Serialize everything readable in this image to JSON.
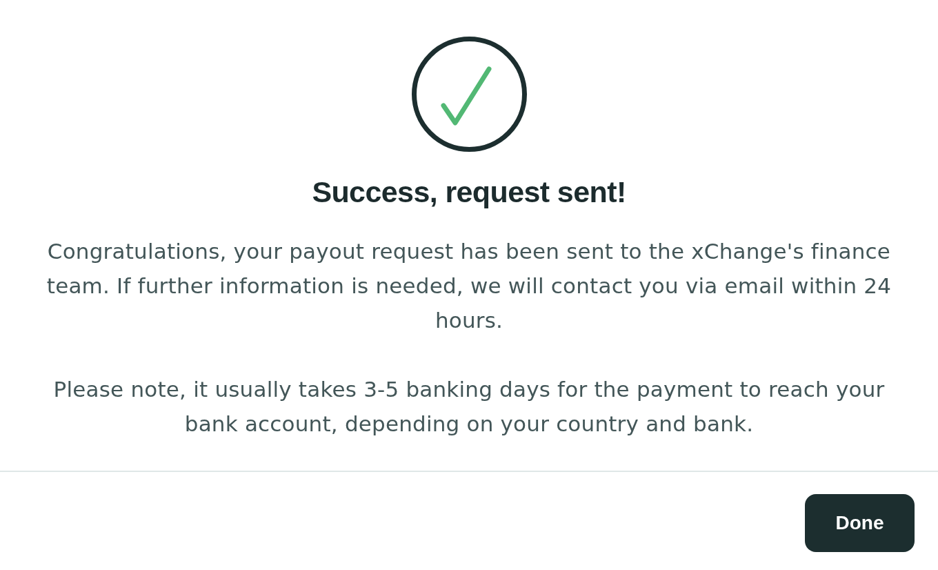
{
  "dialog": {
    "title": "Success, request sent!",
    "paragraphs": [
      "Congratulations, your payout request has been sent to the xChange's finance team. If further information is needed, we will contact you via email within 24 hours.",
      "Please note, it usually takes 3-5 banking days for the payment to reach your bank account, depending on your country and bank."
    ],
    "buttons": [
      {
        "label": "Done",
        "kind": "primary"
      }
    ]
  }
}
